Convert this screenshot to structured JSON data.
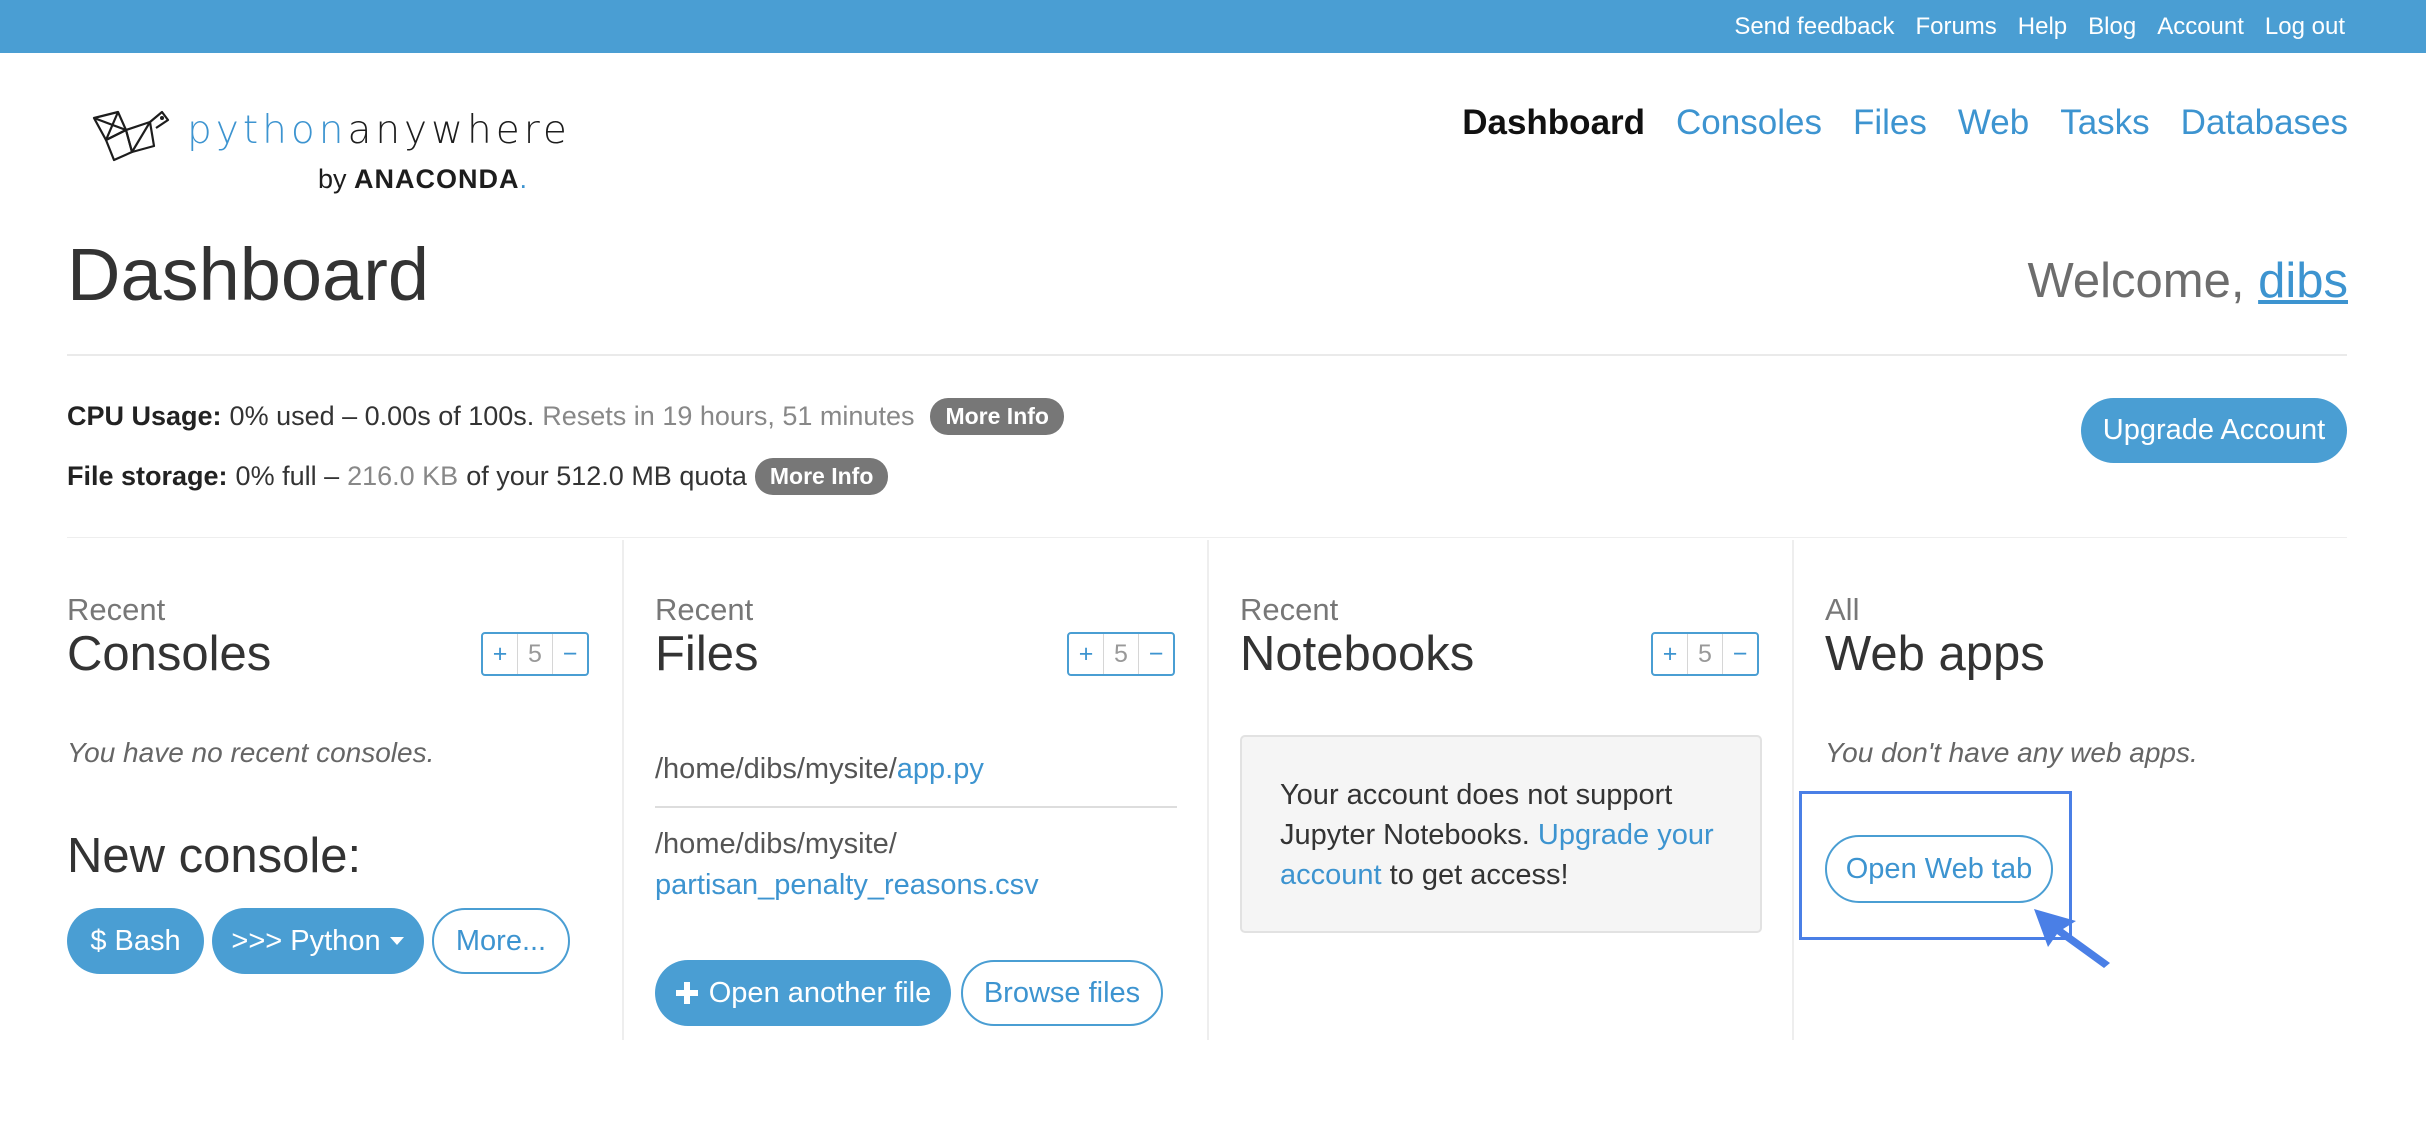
{
  "topbar": {
    "links": [
      "Send feedback",
      "Forums",
      "Help",
      "Blog",
      "Account",
      "Log out"
    ]
  },
  "logo": {
    "word_python": "python",
    "word_anywhere": "anywhere",
    "by": "by",
    "anaconda": "ANACONDA",
    "anaconda_dot": "."
  },
  "nav": {
    "items": [
      "Dashboard",
      "Consoles",
      "Files",
      "Web",
      "Tasks",
      "Databases"
    ],
    "active": "Dashboard"
  },
  "page": {
    "title": "Dashboard",
    "welcome_prefix": "Welcome, ",
    "username": "dibs"
  },
  "usage": {
    "cpu_label": "CPU Usage:",
    "cpu_value": "0% used – 0.00s of 100s.",
    "cpu_reset": "Resets in 19 hours, 51 minutes",
    "more_info": "More Info",
    "storage_label": "File storage:",
    "storage_value_prefix": "0% full –",
    "storage_used": "216.0 KB",
    "storage_suffix": "of your 512.0 MB quota",
    "upgrade_button": "Upgrade Account"
  },
  "consoles": {
    "kicker": "Recent",
    "heading": "Consoles",
    "stepper": {
      "plus": "+",
      "value": "5",
      "minus": "−"
    },
    "empty_note": "You have no recent consoles.",
    "new_console_heading": "New console:",
    "bash_button": "$ Bash",
    "python_button": ">>> Python",
    "more_button": "More..."
  },
  "files": {
    "kicker": "Recent",
    "heading": "Files",
    "stepper": {
      "plus": "+",
      "value": "5",
      "minus": "−"
    },
    "items": [
      {
        "dir": "/home/dibs/mysite/",
        "name": "app.py"
      },
      {
        "dir": "/home/dibs/mysite/",
        "name": "partisan_penalty_reasons.csv"
      }
    ],
    "open_button": "Open another file",
    "browse_button": "Browse files"
  },
  "notebooks": {
    "kicker": "Recent",
    "heading": "Notebooks",
    "stepper": {
      "plus": "+",
      "value": "5",
      "minus": "−"
    },
    "notice_text_1": "Your account does not support Jupyter Notebooks.",
    "notice_link": "Upgrade your account",
    "notice_text_2": "to get access!"
  },
  "webapps": {
    "kicker": "All",
    "heading": "Web apps",
    "empty_note": "You don't have any web apps.",
    "open_web_tab_button": "Open Web tab"
  },
  "colors": {
    "brand_blue": "#4a9ed3",
    "link_blue": "#3d94d0",
    "highlight_blue": "#4a7fe6",
    "pill_gray": "#777777"
  }
}
